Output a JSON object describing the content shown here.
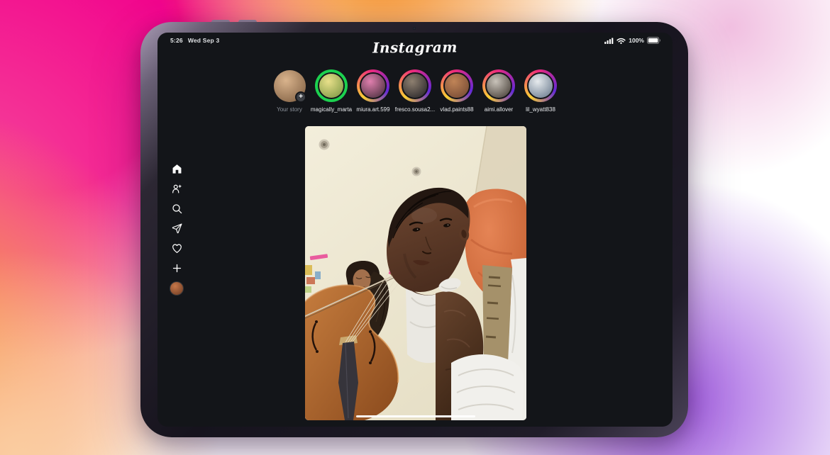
{
  "device": {
    "type": "iPad",
    "camera_icon": "front-camera-dot"
  },
  "status_bar": {
    "time": "5:26",
    "date": "Wed Sep 3",
    "battery_percent": "100%",
    "icons": [
      "cellular-signal-icon",
      "wifi-icon",
      "battery-icon"
    ]
  },
  "header": {
    "logo_text": "Instagram"
  },
  "icons": {
    "add_story_glyph": "+"
  },
  "stories": {
    "items": [
      {
        "username": "Your story",
        "ring": "none",
        "add_badge": true,
        "muted_label": true,
        "avatar_colors": [
          "#d9b38c",
          "#7a5a3e"
        ]
      },
      {
        "username": "magically_marta",
        "ring": "green",
        "add_badge": false,
        "muted_label": false,
        "avatar_colors": [
          "#e9e08a",
          "#74923f"
        ]
      },
      {
        "username": "miura.art.599",
        "ring": "gradient",
        "add_badge": false,
        "muted_label": false,
        "avatar_colors": [
          "#e07fae",
          "#3c2833"
        ]
      },
      {
        "username": "fresco.sousa2...",
        "ring": "gradient",
        "add_badge": false,
        "muted_label": false,
        "avatar_colors": [
          "#8e8070",
          "#1f1d22"
        ]
      },
      {
        "username": "vlad.paints88",
        "ring": "gradient",
        "add_badge": false,
        "muted_label": false,
        "avatar_colors": [
          "#c08457",
          "#6e4430"
        ]
      },
      {
        "username": "aimi.allover",
        "ring": "gradient",
        "add_badge": false,
        "muted_label": false,
        "avatar_colors": [
          "#c9c3ba",
          "#3b332c"
        ]
      },
      {
        "username": "lil_wyatt838",
        "ring": "gradient",
        "add_badge": false,
        "muted_label": false,
        "avatar_colors": [
          "#e7ebee",
          "#5f7186"
        ]
      }
    ]
  },
  "sidebar": {
    "items": [
      {
        "name": "home",
        "icon": "home-icon",
        "active": true
      },
      {
        "name": "friends",
        "icon": "person-star-icon"
      },
      {
        "name": "search",
        "icon": "search-icon"
      },
      {
        "name": "messages",
        "icon": "paper-plane-icon"
      },
      {
        "name": "notifications",
        "icon": "heart-icon"
      },
      {
        "name": "create",
        "icon": "plus-icon"
      },
      {
        "name": "profile",
        "icon": "profile-avatar"
      }
    ]
  },
  "feed": {
    "post": {
      "media_description": "two people, one playing cello, selfie angle",
      "progress_indicator": true
    }
  },
  "colors": {
    "story_ring_gradient": [
      "#f9ce34",
      "#ee2a7b",
      "#6228d7"
    ],
    "close_friends_green": "#1cd14f",
    "screen_bg": "#131519"
  }
}
